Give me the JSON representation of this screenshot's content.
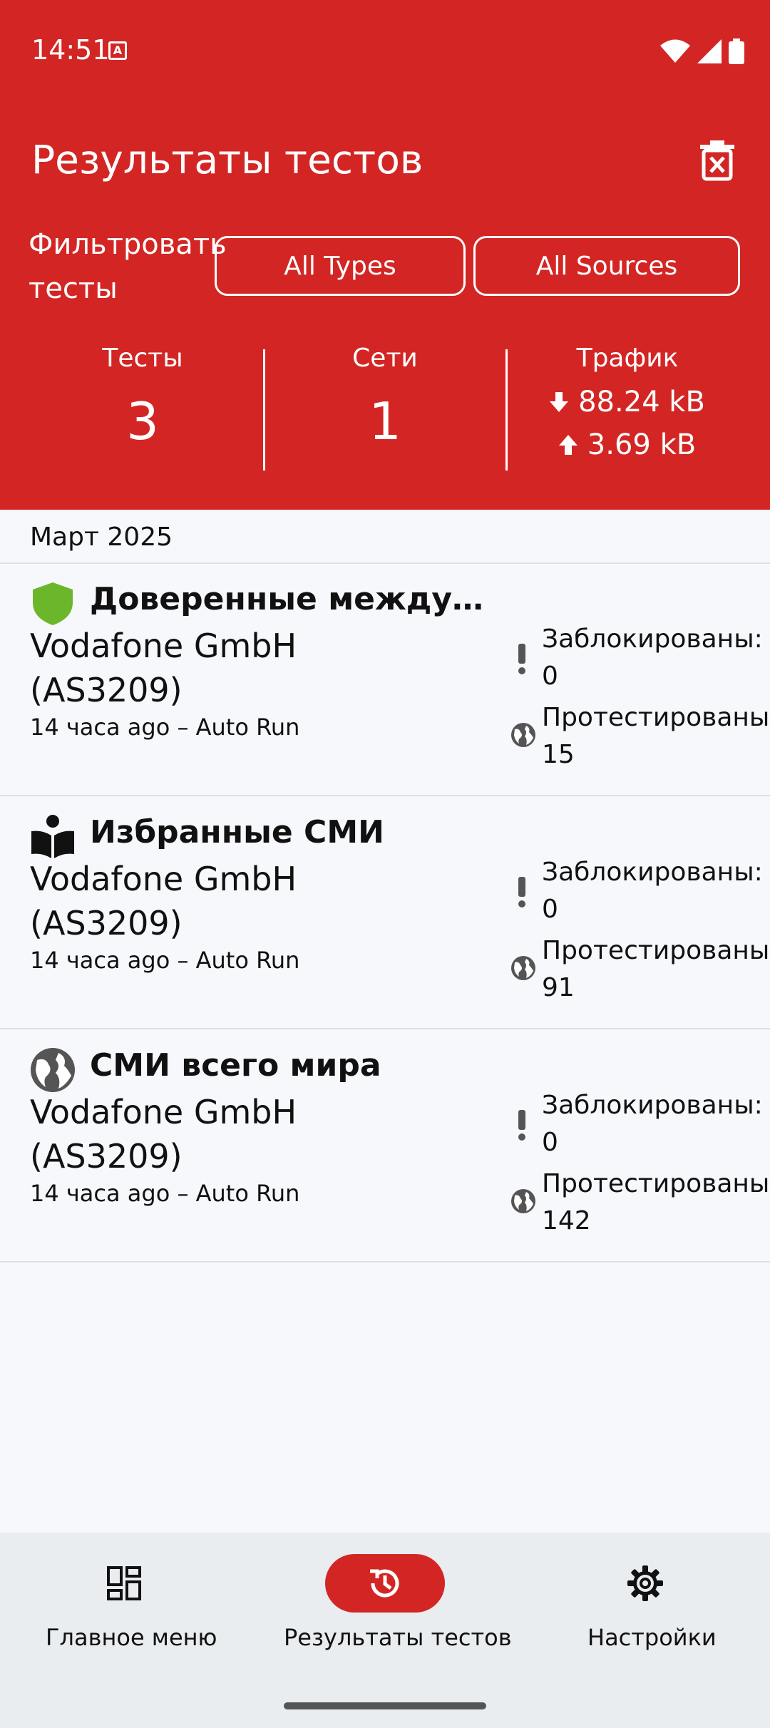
{
  "status_bar": {
    "time": "14:51",
    "app_icon": "A"
  },
  "header": {
    "title": "Результаты тестов",
    "filter_label": "Фильтровать тесты",
    "filter_types": "All Types",
    "filter_sources": "All Sources"
  },
  "stats": {
    "tests_label": "Тесты",
    "tests_value": "3",
    "networks_label": "Сети",
    "networks_value": "1",
    "traffic_label": "Трафик",
    "download": "88.24 kB",
    "upload": "3.69 kB"
  },
  "month": "Март 2025",
  "items": [
    {
      "icon": "shield-icon",
      "icon_color": "#6BB62A",
      "title": "Доверенные междунар...",
      "network": "Vodafone GmbH (AS3209)",
      "meta": "14 часа ago – Auto Run",
      "blocked": "Заблокированы: 0",
      "tested": "Протестированы: 15"
    },
    {
      "icon": "book-reader-icon",
      "icon_color": "#111111",
      "title": "Избранные СМИ",
      "network": "Vodafone GmbH (AS3209)",
      "meta": "14 часа ago – Auto Run",
      "blocked": "Заблокированы: 0",
      "tested": "Протестированы: 91"
    },
    {
      "icon": "globe-icon",
      "icon_color": "#555555",
      "title": "СМИ всего мира",
      "network": "Vodafone GmbH (AS3209)",
      "meta": "14 часа ago – Auto Run",
      "blocked": "Заблокированы: 0",
      "tested": "Протестированы: 142"
    }
  ],
  "nav": {
    "home": "Главное меню",
    "results": "Результаты тестов",
    "settings": "Настройки"
  },
  "colors": {
    "brand": "#D32624",
    "background": "#F6F8FC",
    "nav_background": "#E9EDF0"
  }
}
